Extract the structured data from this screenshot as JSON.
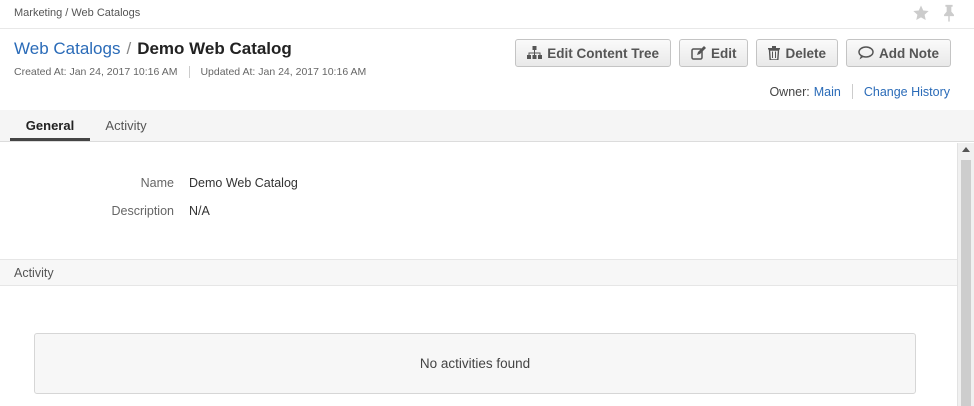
{
  "breadcrumb": {
    "section": "Marketing",
    "separator": "/",
    "page": "Web Catalogs"
  },
  "header": {
    "parent_link": "Web Catalogs",
    "separator": "/",
    "title": "Demo Web Catalog",
    "created": "Created At: Jan 24, 2017 10:16 AM",
    "updated": "Updated At: Jan 24, 2017 10:16 AM"
  },
  "actions": {
    "edit_content_tree": "Edit Content Tree",
    "edit": "Edit",
    "delete": "Delete",
    "add_note": "Add Note"
  },
  "owner": {
    "label": "Owner:",
    "value": "Main",
    "change_history": "Change History"
  },
  "tabs": [
    {
      "label": "General",
      "active": true
    },
    {
      "label": "Activity",
      "active": false
    }
  ],
  "general": {
    "fields": [
      {
        "label": "Name",
        "value": "Demo Web Catalog"
      },
      {
        "label": "Description",
        "value": "N/A"
      }
    ]
  },
  "activity_section": {
    "title": "Activity",
    "empty_message": "No activities found"
  },
  "icons": {
    "favorite": "star-icon",
    "pin": "pin-icon",
    "edit_content_tree": "sitemap-icon",
    "edit": "pencil-square-icon",
    "delete": "trash-icon",
    "add_note": "speech-bubble-icon"
  },
  "colors": {
    "link": "#2a6bb8",
    "icon_inactive": "#cccccc"
  }
}
